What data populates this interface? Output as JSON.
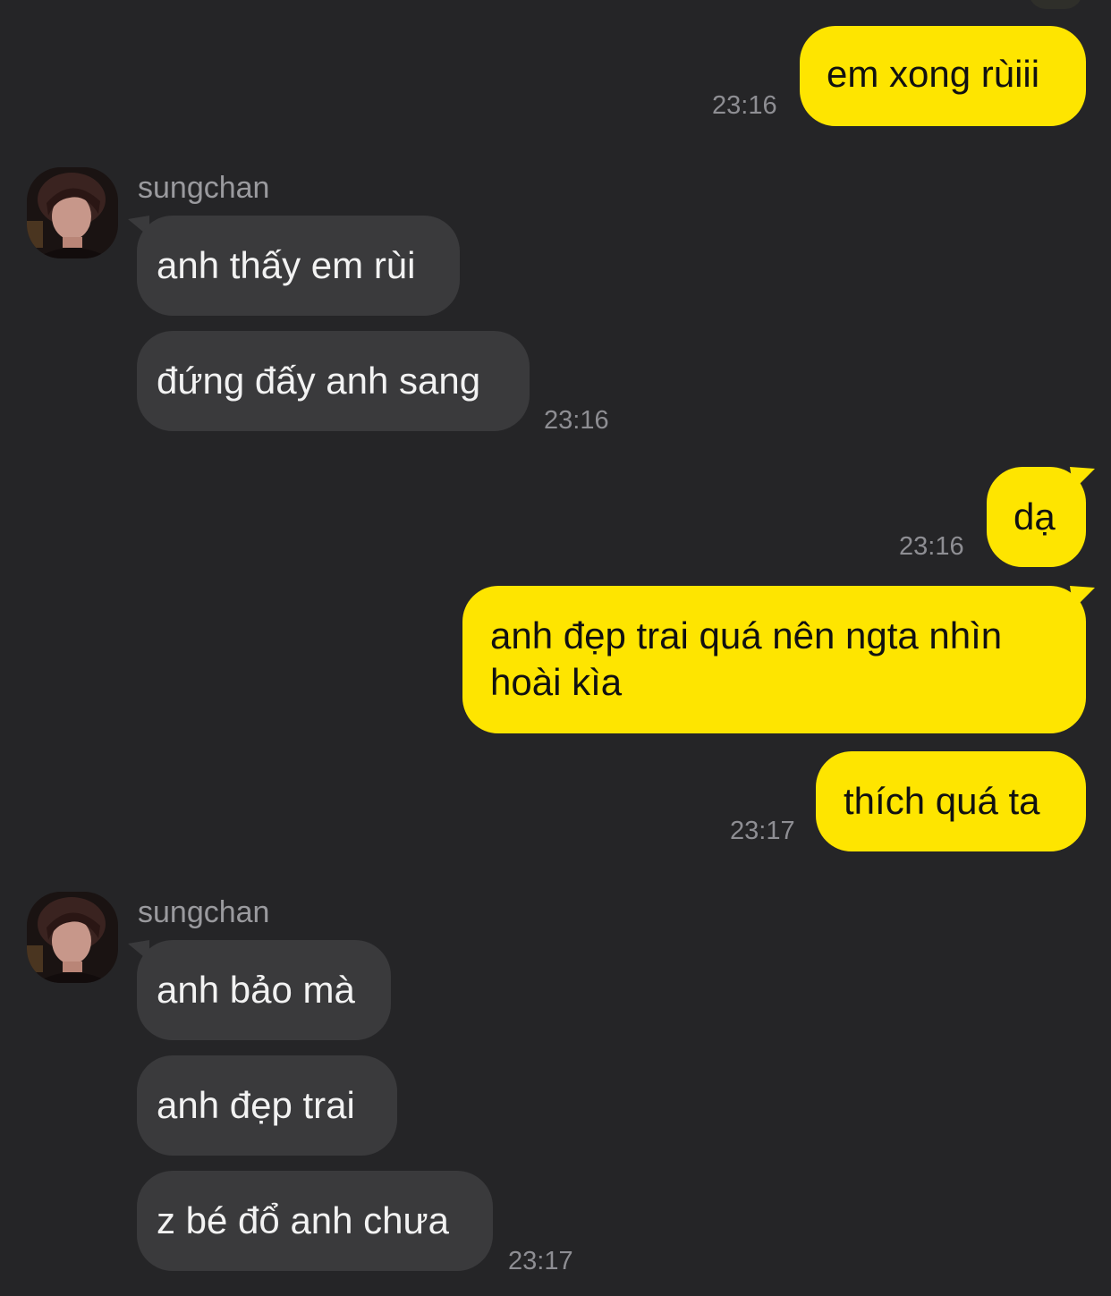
{
  "chat": {
    "messages": [
      {
        "from": "me",
        "text": "em xong rùiii",
        "time": "23:16"
      },
      {
        "from": "sungchan",
        "sender": "sungchan",
        "text": "anh thấy em rùi"
      },
      {
        "from": "sungchan",
        "text": "đứng đấy anh sang",
        "time": "23:16"
      },
      {
        "from": "me",
        "text": "dạ",
        "time": "23:16"
      },
      {
        "from": "me",
        "text_line1": "anh đẹp trai quá nên ngta nhìn",
        "text_line2": "hoài kìa"
      },
      {
        "from": "me",
        "text": "thích quá ta",
        "time": "23:17"
      },
      {
        "from": "sungchan",
        "sender": "sungchan",
        "text": "anh bảo mà"
      },
      {
        "from": "sungchan",
        "text": "anh đẹp trai"
      },
      {
        "from": "sungchan",
        "text": "z bé đổ anh chưa",
        "time": "23:17"
      }
    ]
  },
  "colors": {
    "background": "#252527",
    "outgoing_bubble": "#FEE500",
    "incoming_bubble": "#3A3A3C",
    "timestamp": "#8E8E93"
  },
  "icons": {
    "avatar": "profile-photo"
  }
}
